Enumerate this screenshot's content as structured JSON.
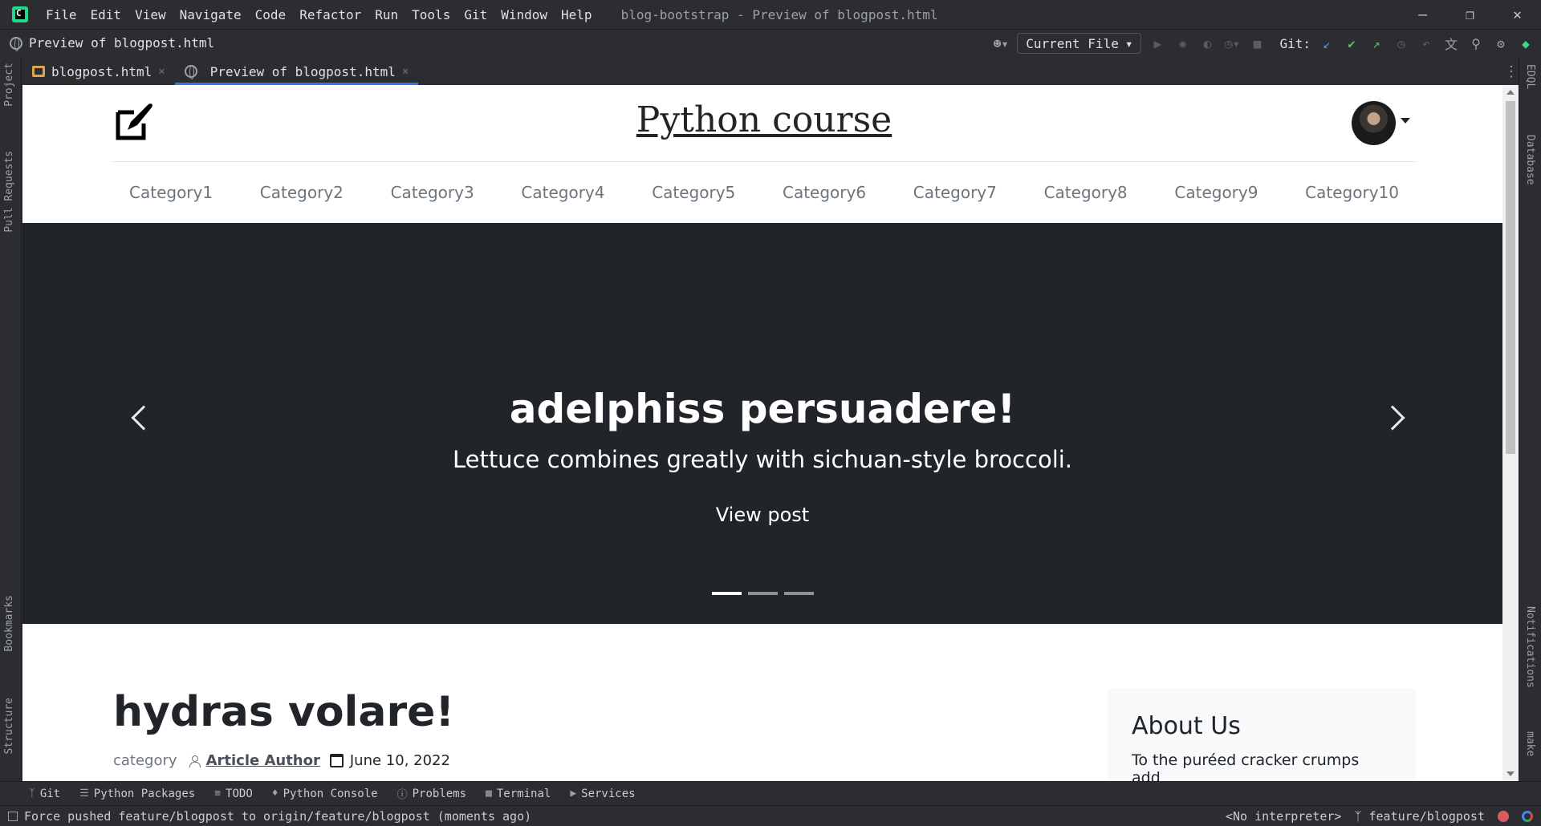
{
  "menu": {
    "items": [
      "File",
      "Edit",
      "View",
      "Navigate",
      "Code",
      "Refactor",
      "Run",
      "Tools",
      "Git",
      "Window",
      "Help"
    ],
    "window_title": "blog-bootstrap - Preview of blogpost.html"
  },
  "navbar": {
    "file_label": "Preview of blogpost.html",
    "run_config": "Current File",
    "git_label": "Git:"
  },
  "left_strip": [
    "Project",
    "Pull Requests",
    "Bookmarks",
    "Structure"
  ],
  "right_strip": [
    "EDQL",
    "Database",
    "Notifications",
    "make"
  ],
  "tabs": [
    {
      "label": "blogpost.html",
      "active": false
    },
    {
      "label": "Preview of blogpost.html",
      "active": true
    }
  ],
  "site": {
    "title": "Python course",
    "categories": [
      "Category1",
      "Category2",
      "Category3",
      "Category4",
      "Category5",
      "Category6",
      "Category7",
      "Category8",
      "Category9",
      "Category10"
    ],
    "carousel": {
      "title": "adelphiss persuadere!",
      "subtitle": "Lettuce combines greatly with sichuan-style broccoli.",
      "link": "View post",
      "slides": 3,
      "active_slide": 1
    },
    "article": {
      "title": "hydras volare!",
      "category": "category",
      "author": "Article Author",
      "date": "June 10, 2022"
    },
    "about": {
      "title": "About Us",
      "text": "To the puréed cracker crumps add"
    }
  },
  "bottom_tools": [
    "Git",
    "Python Packages",
    "TODO",
    "Python Console",
    "Problems",
    "Terminal",
    "Services"
  ],
  "status": {
    "message": "Force pushed feature/blogpost to origin/feature/blogpost (moments ago)",
    "interpreter": "<No interpreter>",
    "branch": "feature/blogpost"
  },
  "colors": {
    "ide_bg": "#2b2d30",
    "accent": "#3574f0",
    "carousel_bg": "#212529"
  }
}
